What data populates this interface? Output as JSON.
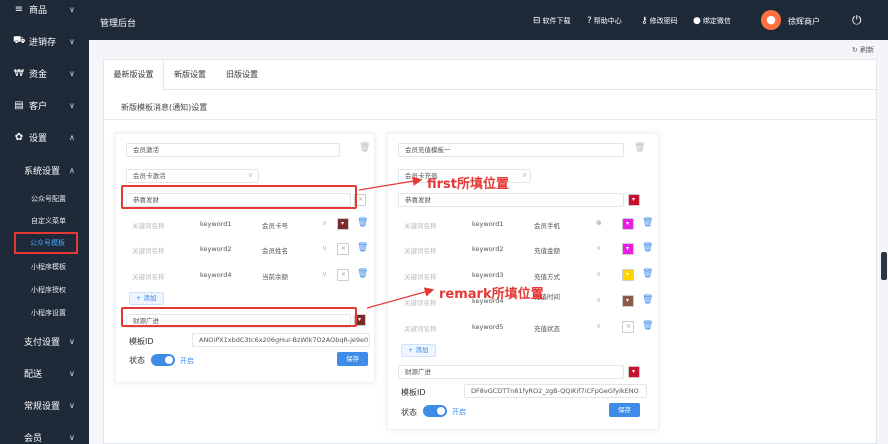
{
  "sidebar": {
    "items": [
      {
        "label": "商品",
        "icon": "≡"
      },
      {
        "label": "进销存",
        "icon": "⛟"
      },
      {
        "label": "资金",
        "icon": "₩"
      },
      {
        "label": "客户",
        "icon": "▤"
      },
      {
        "label": "设置",
        "icon": "✿"
      },
      {
        "label": "系统设置"
      },
      {
        "label": "支付设置"
      },
      {
        "label": "配送"
      },
      {
        "label": "常规设置"
      },
      {
        "label": "会员"
      }
    ],
    "sub_items": [
      "公众号配置",
      "自定义菜单",
      "公众号模板",
      "小程序模板",
      "小程序授权",
      "小程序设置"
    ],
    "chevron_down": "∨",
    "chevron_up": "∧"
  },
  "header": {
    "title": "管理后台",
    "links": [
      {
        "icon": "⊟",
        "label": "软件下载"
      },
      {
        "icon": "?",
        "label": "帮助中心"
      },
      {
        "icon": "⚷",
        "label": "修改密码"
      },
      {
        "icon": "●",
        "label": "绑定微信"
      }
    ],
    "avatar_icon": "●",
    "shop_name": "徐辉商户",
    "power_icon": "⏻"
  },
  "refresh_label": "刷新",
  "tabs": [
    "最新版设置",
    "新版设置",
    "旧版设置"
  ],
  "section_title": "新版模板消息(通知)设置",
  "left_panel": {
    "name_value": "会员激活",
    "type_value": "会员卡激活",
    "first_value": "恭喜发财",
    "keywords": [
      {
        "placeholder": "关键词名称",
        "key": "keyword1",
        "value": "会员卡号"
      },
      {
        "placeholder": "关键词名称",
        "key": "keyword2",
        "value": "会员姓名"
      },
      {
        "placeholder": "关键词名称",
        "key": "keyword4",
        "value": "当前余额"
      }
    ],
    "add_label": "+ 添加",
    "remark_value": "财源广进",
    "template_id_label": "模板ID",
    "template_id_value": "ANOiPX1xbdC3tc6x206gHur-BzWlk7O2AObqR-je9e0",
    "status_label": "状态",
    "status_on": "开启",
    "save_label": "保存"
  },
  "right_panel": {
    "name_value": "会员充值模板一",
    "type_value": "会员卡充值",
    "first_value": "恭喜发财",
    "keywords": [
      {
        "placeholder": "关键词名称",
        "key": "keyword1",
        "value": "会员手机"
      },
      {
        "placeholder": "关键词名称",
        "key": "keyword2",
        "value": "充值金额"
      },
      {
        "placeholder": "关键词名称",
        "key": "keyword3",
        "value": "充值方式"
      },
      {
        "placeholder": "关键词名称",
        "key": "keyword4",
        "value": "充值时间"
      },
      {
        "placeholder": "关键词名称",
        "key": "keyword5",
        "value": "充值状态"
      }
    ],
    "add_label": "+ 添加",
    "remark_value": "财源广进",
    "template_id_label": "模板ID",
    "template_id_value": "DF8vGCDTTn81fyRO2_zgB-QQiKif7iCFpGeGfyIkENO",
    "status_label": "状态",
    "status_on": "开启",
    "save_label": "保存"
  },
  "annotations": {
    "first": "first所填位置",
    "remark": "remark所填位置"
  },
  "icons": {
    "trash": "🗑",
    "clear": "×",
    "drop": "▾",
    "arrow": "∨"
  },
  "colors": {
    "sidebar_bg": "#1f2a38",
    "accent": "#3f8be8",
    "annotation": "#e53935",
    "swatch_dark": "#7a2b2b",
    "swatch_red": "#c8102e",
    "swatch_magenta": "#e91ee3",
    "swatch_yellow": "#ffd400",
    "swatch_brown": "#8a5a4a"
  }
}
